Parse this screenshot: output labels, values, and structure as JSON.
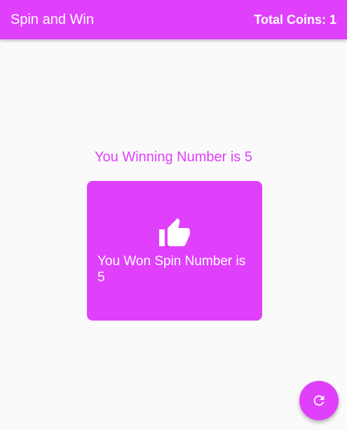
{
  "app_bar": {
    "title": "Spin and Win",
    "coins_label": "Total Coins: 1"
  },
  "main": {
    "winning_text": "You Winning Number is 5",
    "result_card": {
      "icon": "thumb-up-icon",
      "message": "You Won Spin Number is 5"
    }
  },
  "fab": {
    "icon": "refresh-icon"
  },
  "colors": {
    "accent": "#e040fb",
    "background": "#fafafa",
    "on_accent": "#ffffff"
  }
}
